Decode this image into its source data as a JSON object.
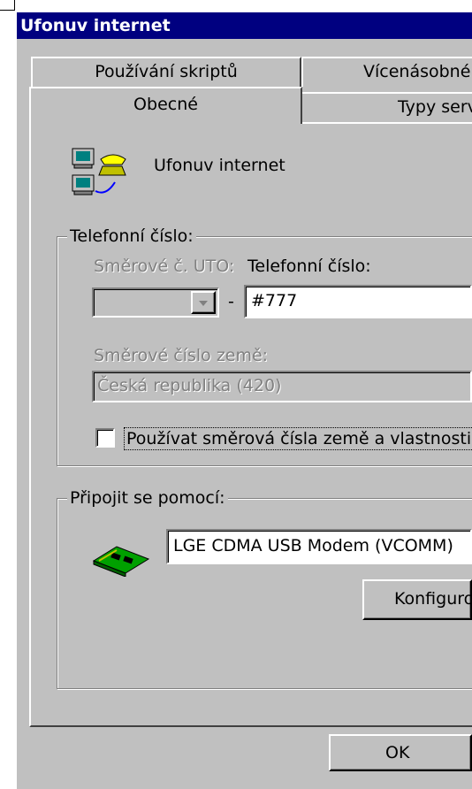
{
  "window": {
    "title": "Ufonuv internet"
  },
  "tabs": {
    "row1": [
      {
        "label": "Používání skriptů"
      },
      {
        "label": "Vícenásobné"
      }
    ],
    "row2": [
      {
        "label": "Obecné"
      },
      {
        "label": "Typy serv"
      }
    ]
  },
  "connection": {
    "name": "Ufonuv internet",
    "icon": "dialup-connection-icon"
  },
  "phone_group": {
    "legend": "Telefonní číslo:",
    "area_code_label": "Směrové č. UTO:",
    "phone_label": "Telefonní číslo:",
    "separator": "-",
    "area_code_value": "",
    "phone_value": "#777",
    "country_label": "Směrové číslo země:",
    "country_value": "Česká republika (420)",
    "use_country_checkbox_label": "Používat směrová čísla země a vlastnosti",
    "use_country_checked": false
  },
  "connect_group": {
    "legend": "Připojit se pomocí:",
    "modem_value": "LGE CDMA USB Modem (VCOMM)",
    "modem_icon": "modem-card-icon",
    "configure_button": "Konfiguro"
  },
  "footer": {
    "ok_button": "OK"
  }
}
